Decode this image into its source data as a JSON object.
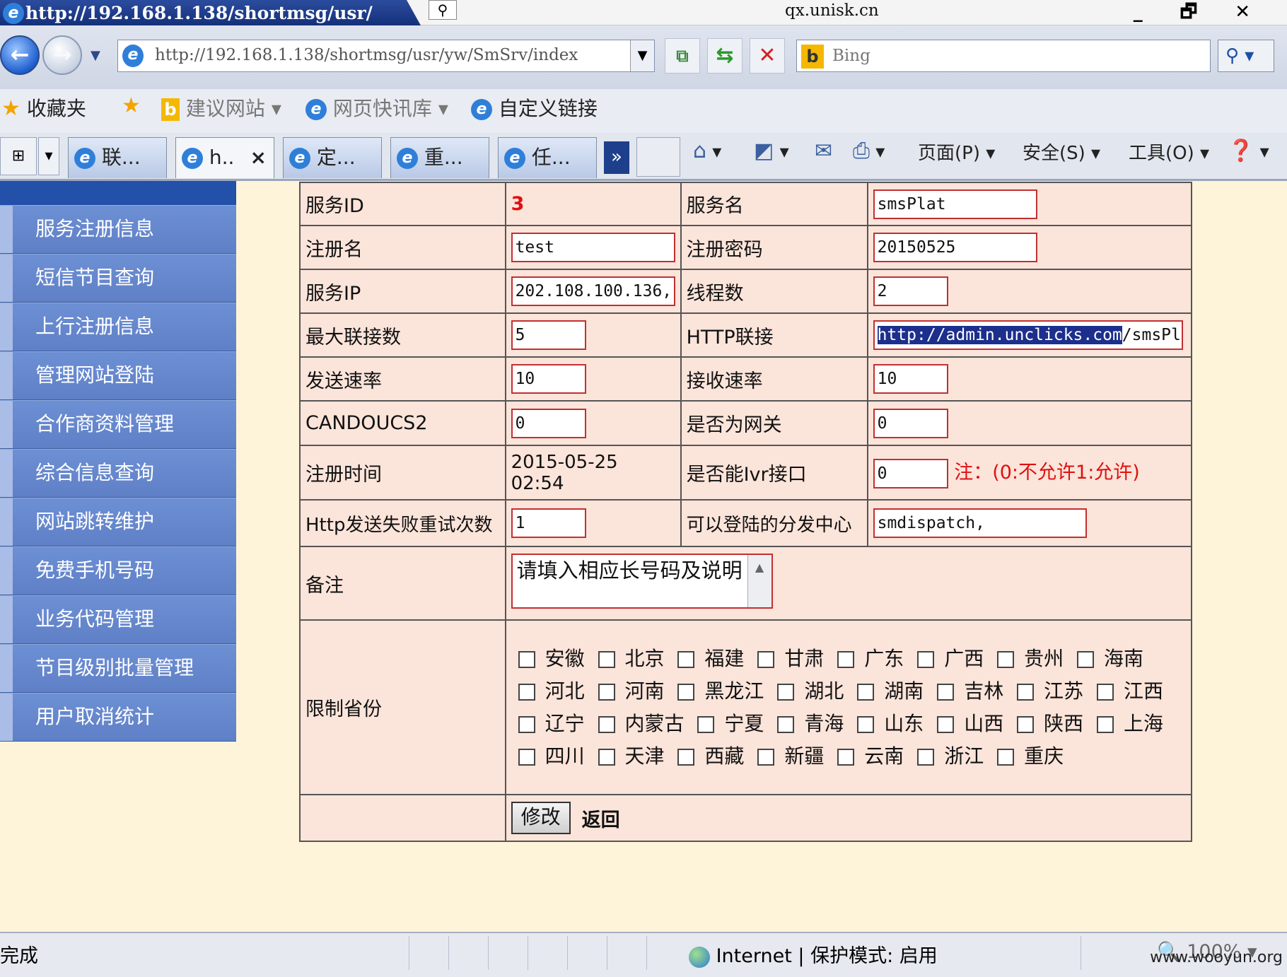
{
  "browser": {
    "tab_title": "http://192.168.1.138/shortmsg/usr/",
    "window_center_text": "qx.unisk.cn",
    "window_buttons": "_ 🗗 ✕",
    "address": "http://192.168.1.138/shortmsg/usr/yw/SmSrv/index",
    "search_placeholder": "Bing",
    "favorites": {
      "favorites_label": "收藏夹",
      "suggested_sites": "建议网站",
      "web_slices": "网页快讯库",
      "custom_links": "自定义链接"
    },
    "tabs": [
      {
        "label": "联..."
      },
      {
        "label": "h.."
      },
      {
        "label": "定..."
      },
      {
        "label": "重..."
      },
      {
        "label": "任..."
      }
    ],
    "tab_more": "»",
    "commands": {
      "page": "页面(P)",
      "safety": "安全(S)",
      "tools": "工具(O)"
    }
  },
  "sidebar": {
    "items": [
      {
        "label": "服务注册信息"
      },
      {
        "label": "短信节目查询"
      },
      {
        "label": "上行注册信息"
      },
      {
        "label": "管理网站登陆"
      },
      {
        "label": "合作商资料管理"
      },
      {
        "label": "综合信息查询"
      },
      {
        "label": "网站跳转维护"
      },
      {
        "label": "免费手机号码"
      },
      {
        "label": "业务代码管理"
      },
      {
        "label": "节目级别批量管理"
      },
      {
        "label": "用户取消统计"
      }
    ]
  },
  "form": {
    "service_id_label": "服务ID",
    "service_id": "3",
    "service_name_label": "服务名",
    "service_name": "smsPlat",
    "reg_name_label": "注册名",
    "reg_name": "test",
    "reg_password_label": "注册密码",
    "reg_password": "20150525",
    "service_ip_label": "服务IP",
    "service_ip": "202.108.100.136,",
    "threads_label": "线程数",
    "threads": "2",
    "max_conn_label": "最大联接数",
    "max_conn": "5",
    "http_link_label": "HTTP联接",
    "http_link_selected": "http://admin.unclicks.com",
    "http_link_rest": "/smsPl",
    "send_rate_label": "发送速率",
    "send_rate": "10",
    "recv_rate_label": "接收速率",
    "recv_rate": "10",
    "candoucs2_label": "CANDOUCS2",
    "candoucs2": "0",
    "is_gateway_label": "是否为网关",
    "is_gateway": "0",
    "reg_time_label": "注册时间",
    "reg_time_date": "2015-05-25",
    "reg_time_clock": "02:54",
    "ivr_label": "是否能Ivr接口",
    "ivr": "0",
    "ivr_note": "注：(0:不允许1:允许)",
    "http_retry_label": "Http发送失败重试次数",
    "http_retry": "1",
    "dispatch_label": "可以登陆的分发中心",
    "dispatch": "smdispatch,",
    "remark_label": "备注",
    "remark": "请填入相应长号码及说明",
    "province_label": "限制省份",
    "provinces": [
      "安徽",
      "北京",
      "福建",
      "甘肃",
      "广东",
      "广西",
      "贵州",
      "海南",
      "河北",
      "河南",
      "黑龙江",
      "湖北",
      "湖南",
      "吉林",
      "江苏",
      "江西",
      "辽宁",
      "内蒙古",
      "宁夏",
      "青海",
      "山东",
      "山西",
      "陕西",
      "上海",
      "四川",
      "天津",
      "西藏",
      "新疆",
      "云南",
      "浙江",
      "重庆"
    ],
    "submit_label": "修改",
    "back_label": "返回"
  },
  "status": {
    "left": "完成",
    "zone": "Internet",
    "protected_mode": "保护模式: 启用",
    "zoom": "100%",
    "watermark": "www.wooyun.org"
  }
}
